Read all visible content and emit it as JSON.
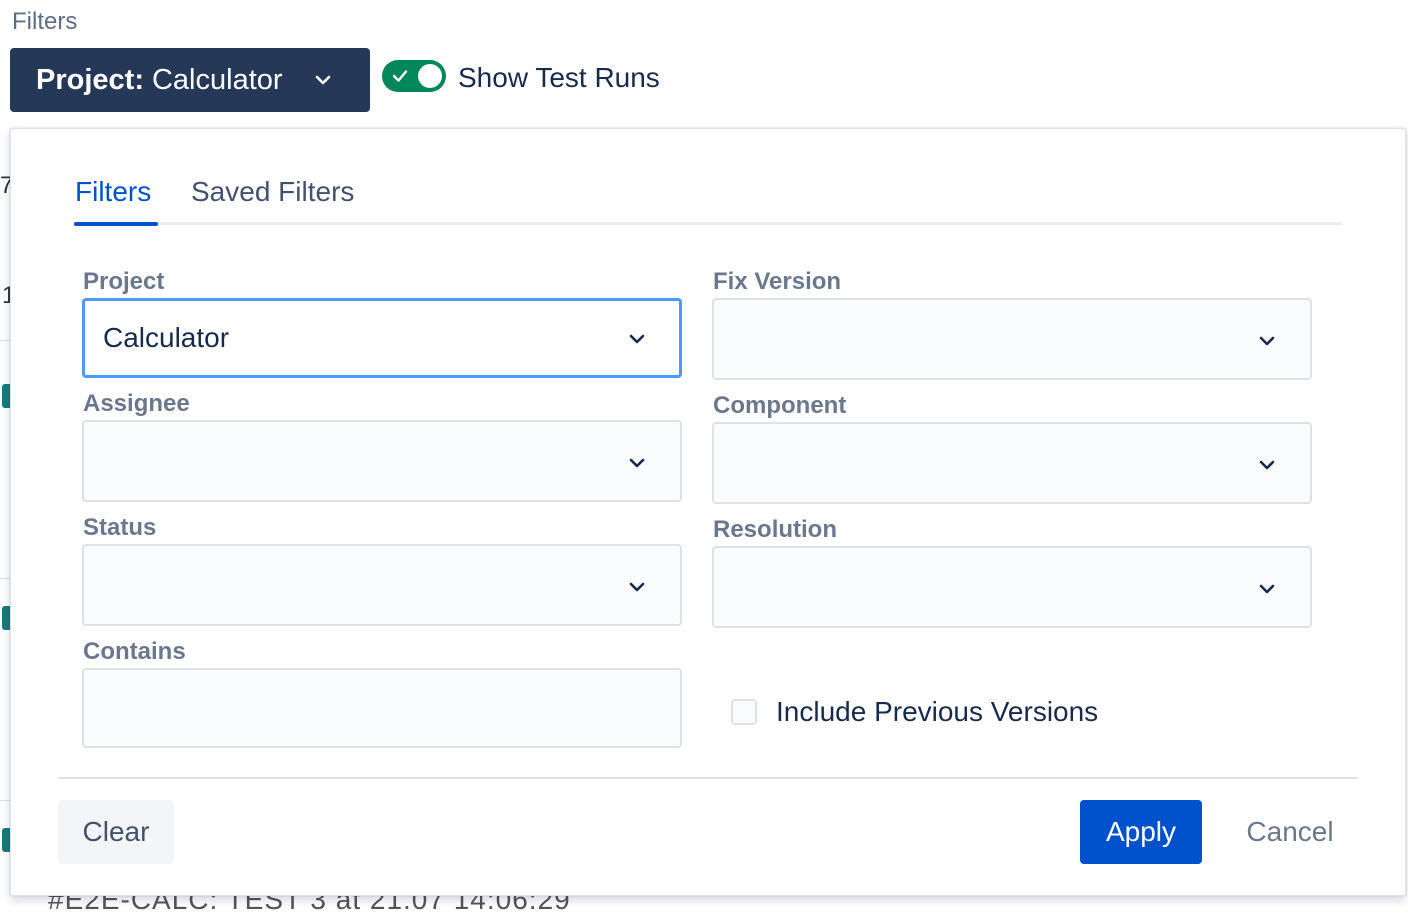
{
  "header": {
    "title": "Filters",
    "project_button": {
      "prefix": "Project:",
      "value": "Calculator"
    },
    "toggle": {
      "label": "Show Test Runs",
      "on": true
    }
  },
  "background": {
    "fragments": [
      "7",
      "1"
    ],
    "bottom_text": "#E2E-CALC: TEST 3 at 21.07 14:06:29"
  },
  "panel": {
    "tabs": [
      {
        "label": "Filters",
        "active": true
      },
      {
        "label": "Saved Filters",
        "active": false
      }
    ],
    "fields": {
      "project": {
        "label": "Project",
        "value": "Calculator"
      },
      "fix_version": {
        "label": "Fix Version",
        "value": ""
      },
      "assignee": {
        "label": "Assignee",
        "value": ""
      },
      "component": {
        "label": "Component",
        "value": ""
      },
      "status": {
        "label": "Status",
        "value": ""
      },
      "resolution": {
        "label": "Resolution",
        "value": ""
      },
      "contains": {
        "label": "Contains",
        "value": ""
      }
    },
    "include_previous": {
      "label": "Include Previous Versions",
      "checked": false
    },
    "buttons": {
      "clear": "Clear",
      "apply": "Apply",
      "cancel": "Cancel"
    }
  },
  "colors": {
    "header_button_bg": "#253858",
    "toggle_on": "#00875a",
    "primary": "#0052cc",
    "focus_border": "#4c9aff"
  }
}
